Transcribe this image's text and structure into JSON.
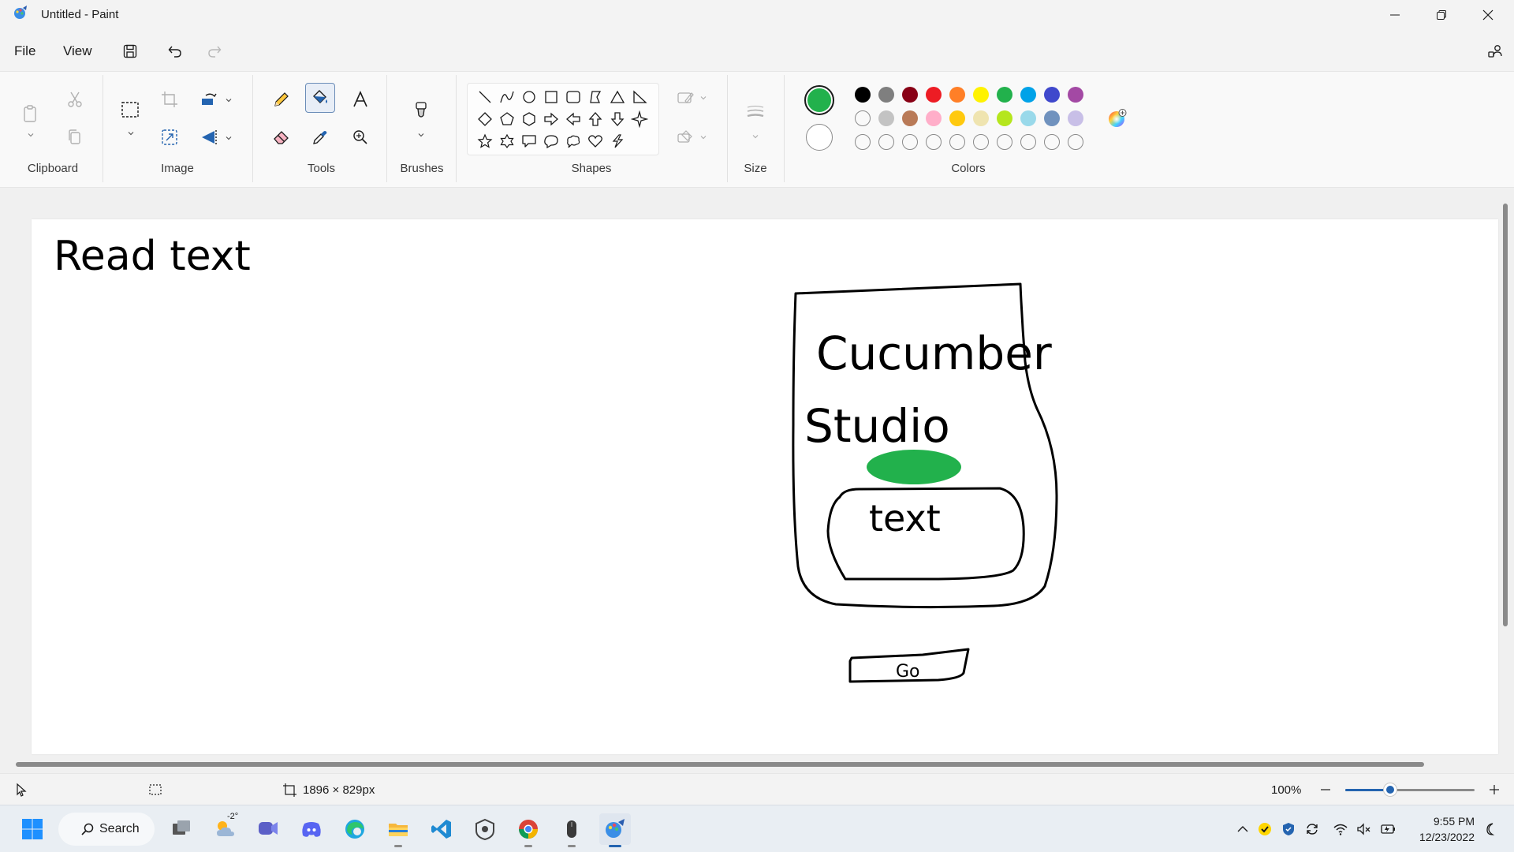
{
  "window": {
    "title": "Untitled - Paint",
    "controls": [
      "minimize",
      "maximize",
      "close"
    ]
  },
  "menu": {
    "items": [
      "File",
      "View"
    ],
    "quick_actions": [
      "save-icon",
      "undo-icon",
      "redo-icon"
    ]
  },
  "ribbon": {
    "groups": {
      "clipboard": "Clipboard",
      "image": "Image",
      "tools": "Tools",
      "brushes": "Brushes",
      "shapes": "Shapes",
      "size": "Size",
      "colors": "Colors"
    },
    "active_tool": "fill-icon",
    "colors": {
      "primary": "#22b14c",
      "secondary": "#ffffff",
      "row1": [
        "#000000",
        "#7f7f7f",
        "#880015",
        "#ed1c24",
        "#ff7f27",
        "#fff200",
        "#22b14c",
        "#00a2e8",
        "#3f48cc",
        "#a349a4"
      ],
      "row2": [
        "",
        "#c3c3c3",
        "#b97a57",
        "#ffaec9",
        "#ffc90e",
        "#efe4b0",
        "#b5e61d",
        "#99d9ea",
        "#7092be",
        "#c8bfe7"
      ],
      "row3": [
        "",
        "",
        "",
        "",
        "",
        "",
        "",
        "",
        "",
        ""
      ]
    }
  },
  "canvas": {
    "drawing": {
      "headline": "Read text",
      "brand_line1": "Cucumber",
      "brand_line2": "Studio",
      "box_label": "text",
      "button_label": "Go",
      "blob_color": "#22b14c"
    }
  },
  "statusbar": {
    "canvas_size": "1896 × 829px",
    "zoom": "100%",
    "zoom_level": 0.35
  },
  "taskbar": {
    "search_label": "Search",
    "weather_temp": "-2°",
    "time": "9:55 PM",
    "date": "12/23/2022"
  }
}
